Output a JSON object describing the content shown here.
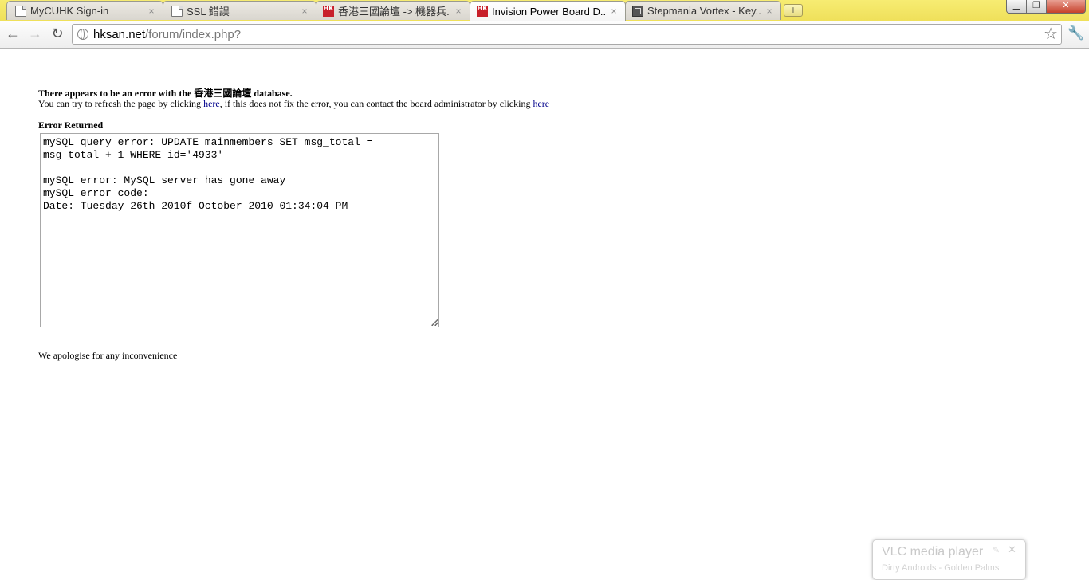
{
  "browser": {
    "tabs": [
      {
        "title": "MyCUHK Sign-in",
        "icon": "page-icon",
        "active": false
      },
      {
        "title": "SSL 錯誤",
        "icon": "page-icon",
        "active": false
      },
      {
        "title": "香港三國論壇 -> 機器兵...",
        "icon": "hksan-icon",
        "active": false
      },
      {
        "title": "Invision Power Board D...",
        "icon": "hksan-icon",
        "active": true
      },
      {
        "title": "Stepmania Vortex - Key...",
        "icon": "stepmania-icon",
        "active": false
      }
    ],
    "tab_close_glyph": "×",
    "new_tab_glyph": "+",
    "icon_hk_text": "HK",
    "window_buttons": {
      "minimize": "▁",
      "restore": "❐",
      "close": "✕"
    },
    "nav": {
      "back": "←",
      "forward": "→",
      "reload": "↻",
      "menu": "🔧",
      "bookmark": "☆"
    },
    "address": {
      "domain": "hksan.net",
      "path": "/forum/index.php?"
    }
  },
  "page": {
    "heading": "There appears to be an error with the 香港三國論壇 database.",
    "sub_before": "You can try to refresh the page by clicking ",
    "link_refresh": "here",
    "sub_middle": ", if this does not fix the error, you can contact the board administrator by clicking ",
    "link_contact": "here",
    "error_label": "Error Returned",
    "error_text": "mySQL query error: UPDATE mainmembers SET msg_total =\nmsg_total + 1 WHERE id='4933'\n\nmySQL error: MySQL server has gone away\nmySQL error code:\nDate: Tuesday 26th 2010f October 2010 01:34:04 PM",
    "footer": "We apologise for any inconvenience"
  },
  "notification": {
    "title": "VLC media player",
    "track": "Dirty Androids - Golden Palms",
    "pin_glyph": "✎",
    "close_glyph": "✕"
  }
}
